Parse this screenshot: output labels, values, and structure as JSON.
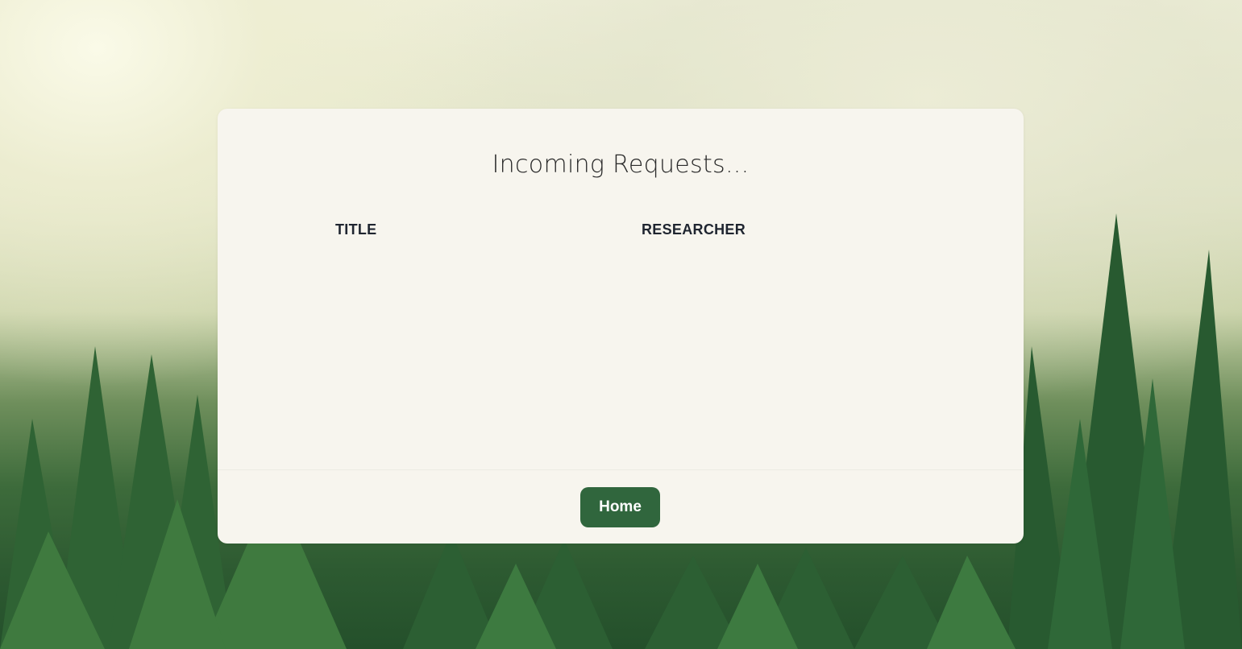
{
  "page": {
    "title": "Incoming Requests..."
  },
  "table": {
    "headers": [
      "TITLE",
      "RESEARCHER"
    ],
    "rows": []
  },
  "footer": {
    "home_label": "Home"
  },
  "colors": {
    "button_bg": "#30663d",
    "card_bg": "#f7f5ee",
    "heading_text": "#2a2a2a",
    "header_text": "#1f2530"
  }
}
